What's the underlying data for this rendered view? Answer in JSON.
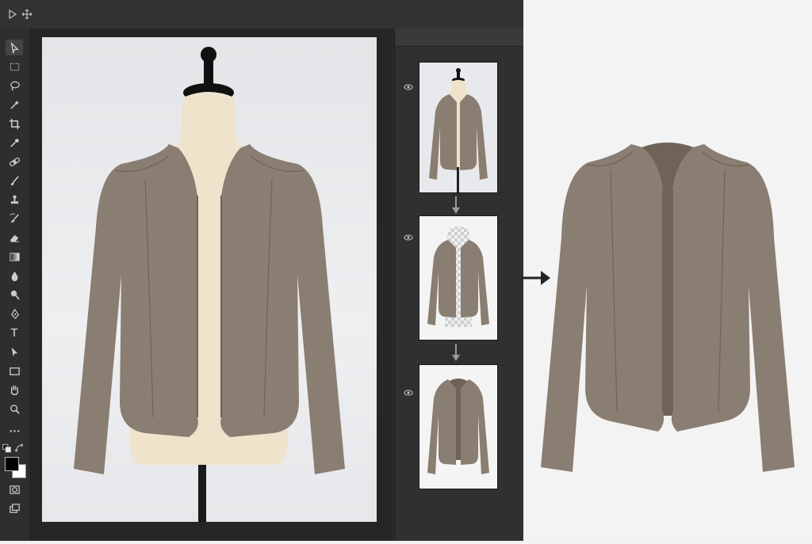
{
  "app": {
    "topbar_icons": [
      "play-icon",
      "move-icon"
    ],
    "tools": [
      "selection-arrow-icon",
      "marquee-icon",
      "lasso-icon",
      "magic-wand-icon",
      "crop-icon",
      "eyedropper-icon",
      "healing-bandage-icon",
      "brush-icon",
      "stamp-icon",
      "history-brush-icon",
      "eraser-icon",
      "gradient-icon",
      "blur-drop-icon",
      "dodge-icon",
      "pen-icon",
      "type-icon",
      "path-select-icon",
      "rectangle-icon",
      "hand-icon",
      "zoom-icon",
      "more-icon",
      "swap-colors-icon",
      "color-swatches-icon",
      "quick-mask-icon",
      "screen-mode-icon"
    ],
    "type_tool_glyph": "T"
  },
  "layers_panel": {
    "layers": [
      {
        "name": "original-mannequin-photo",
        "visible": true
      },
      {
        "name": "background-removed-photo",
        "visible": true
      },
      {
        "name": "ghost-mannequin-result",
        "visible": true
      }
    ]
  },
  "colors": {
    "jacket": "#8a7d71",
    "jacket_dark": "#6f6358",
    "mannequin": "#efe3cc",
    "ui_dark": "#2b2b2b",
    "foreground": "#000000",
    "background": "#ffffff"
  }
}
